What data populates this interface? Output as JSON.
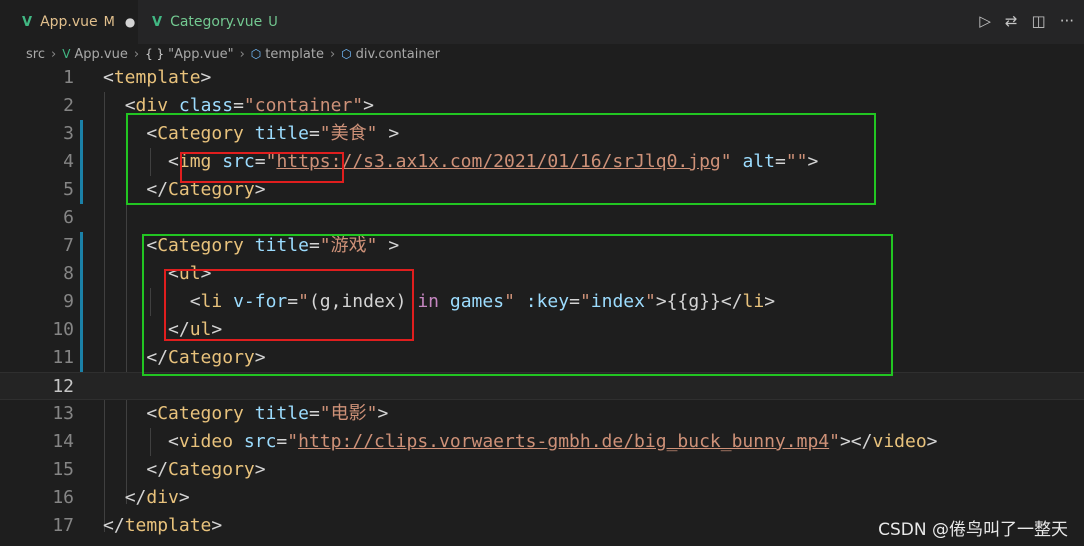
{
  "tabs": [
    {
      "name": "App.vue",
      "status": "M",
      "dirty_marker": "●"
    },
    {
      "name": "Category.vue",
      "status": "U"
    }
  ],
  "breadcrumb": [
    "src",
    "App.vue",
    "\"App.vue\"",
    "template",
    "div.container"
  ],
  "breadcrumb_icons": {
    "vue": "V",
    "braces": "{ }",
    "cube": "⬡"
  },
  "icons": {
    "run": "▷",
    "compare": "⇄",
    "split": "◫",
    "more": "···",
    "vue": "V",
    "sep": "›"
  },
  "lines": [
    {
      "num": "1"
    },
    {
      "num": "2"
    },
    {
      "num": "3"
    },
    {
      "num": "4"
    },
    {
      "num": "5"
    },
    {
      "num": "6"
    },
    {
      "num": "7"
    },
    {
      "num": "8"
    },
    {
      "num": "9"
    },
    {
      "num": "10"
    },
    {
      "num": "11"
    },
    {
      "num": "12"
    },
    {
      "num": "13"
    },
    {
      "num": "14"
    },
    {
      "num": "15"
    },
    {
      "num": "16"
    },
    {
      "num": "17"
    }
  ],
  "code": {
    "tag_template": "template",
    "tag_div": "div",
    "tag_category": "Category",
    "tag_img": "img",
    "tag_ul": "ul",
    "tag_li": "li",
    "tag_video": "video",
    "attr_class": "class",
    "attr_title": "title",
    "attr_src": "src",
    "attr_alt": "alt",
    "attr_vfor": "v-for",
    "attr_key": ":key",
    "val_container": "\"container\"",
    "val_food": "\"美食\"",
    "val_games_title": "\"游戏\"",
    "val_movie": "\"电影\"",
    "img_url": "https://s3.ax1x.com/2021/01/16/srJlq0.jpg",
    "video_url": "http://clips.vorwaerts-gmbh.de/big_buck_bunny.mp4",
    "vfor_part1": "(g,index)",
    "vfor_in": "in",
    "vfor_games": "games",
    "key_index": "index",
    "mustache": "{{g}}",
    "empty_string": "\"\"",
    "quote": "\""
  },
  "watermark": "CSDN @倦鸟叫了一整天",
  "colors": {
    "green_box": "#22c522",
    "red_box": "#e01e1e",
    "tag": "#e8c27c",
    "attr": "#9cdcfe",
    "string": "#ce9178"
  }
}
